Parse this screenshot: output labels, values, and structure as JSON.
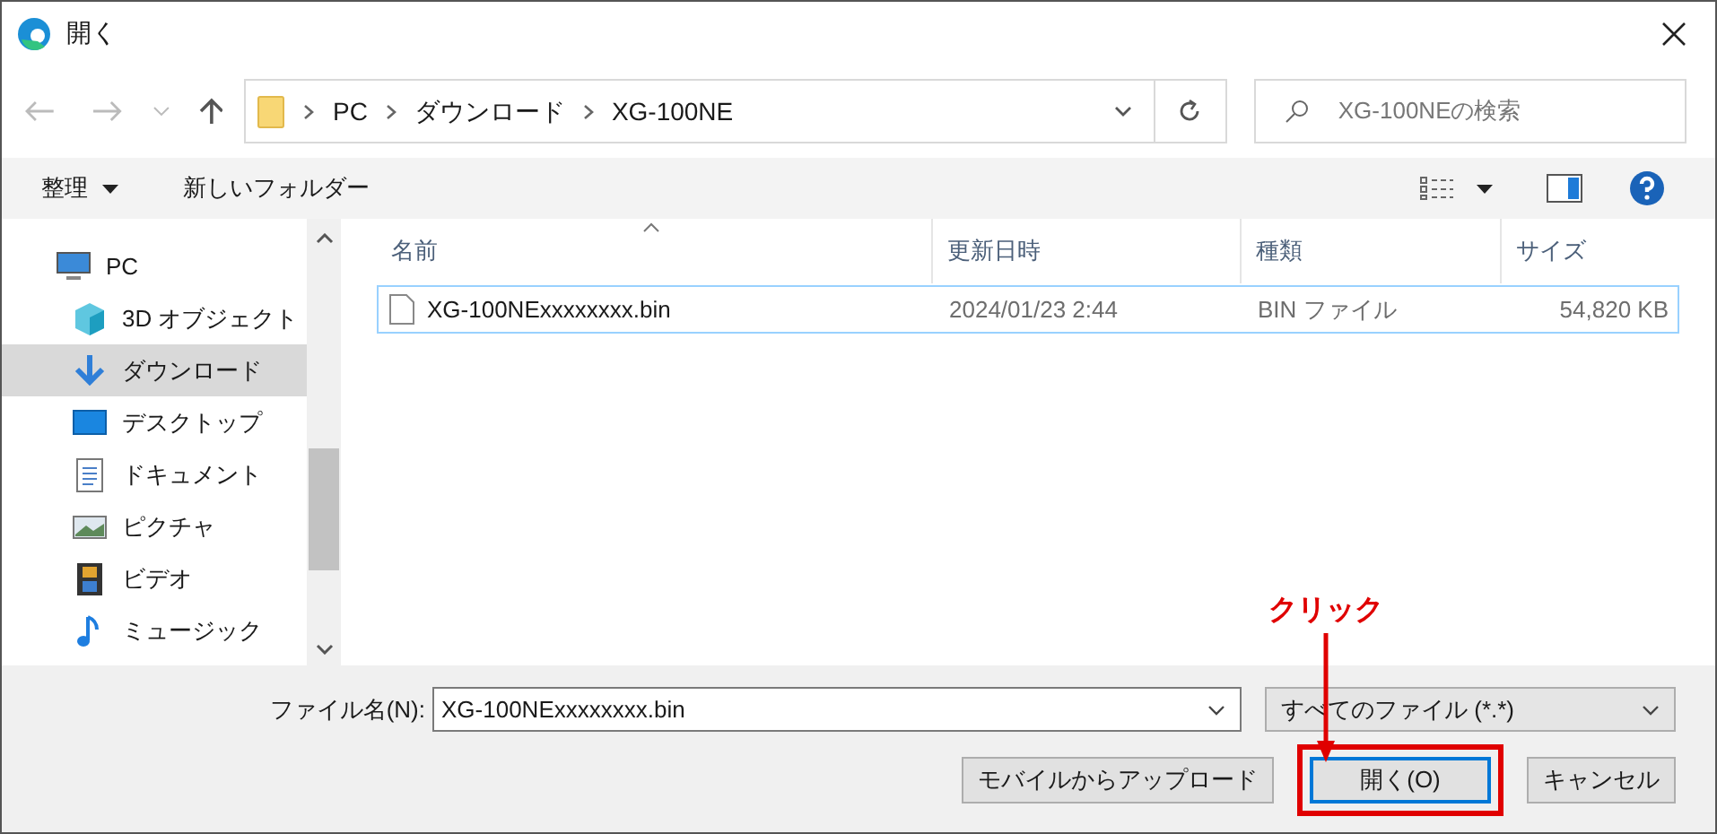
{
  "window": {
    "title": "開く"
  },
  "address": {
    "path": [
      {
        "label": "PC"
      },
      {
        "label": "ダウンロード"
      },
      {
        "label": "XG-100NE"
      }
    ]
  },
  "search": {
    "placeholder": "XG-100NEの検索"
  },
  "toolbar": {
    "organize": "整理",
    "new_folder": "新しいフォルダー"
  },
  "sidebar": {
    "items": [
      {
        "label": "PC",
        "kind": "pc",
        "selected": false,
        "children": [
          {
            "label": "3D オブジェクト",
            "kind": "cube",
            "selected": false
          },
          {
            "label": "ダウンロード",
            "kind": "download",
            "selected": true
          },
          {
            "label": "デスクトップ",
            "kind": "desktop",
            "selected": false
          },
          {
            "label": "ドキュメント",
            "kind": "document",
            "selected": false
          },
          {
            "label": "ピクチャ",
            "kind": "picture",
            "selected": false
          },
          {
            "label": "ビデオ",
            "kind": "video",
            "selected": false
          },
          {
            "label": "ミュージック",
            "kind": "music",
            "selected": false
          }
        ]
      }
    ]
  },
  "table": {
    "columns": [
      "名前",
      "更新日時",
      "種類",
      "サイズ"
    ],
    "rows": [
      {
        "cells": [
          "XG-100NExxxxxxxx.bin",
          "2024/01/23 2:44",
          "BIN ファイル",
          "54,820 KB"
        ],
        "selected": true
      }
    ]
  },
  "footer": {
    "filename_label": "ファイル名(N):",
    "filename": "XG-100NExxxxxxxx.bin",
    "filter": "すべてのファイル (*.*)",
    "buttons": [
      {
        "label": "モバイルからアップロード",
        "kind": "normal"
      },
      {
        "label": "開く(O)",
        "kind": "default"
      },
      {
        "label": "キャンセル",
        "kind": "normal"
      }
    ]
  },
  "annotation": {
    "text": "クリック"
  }
}
